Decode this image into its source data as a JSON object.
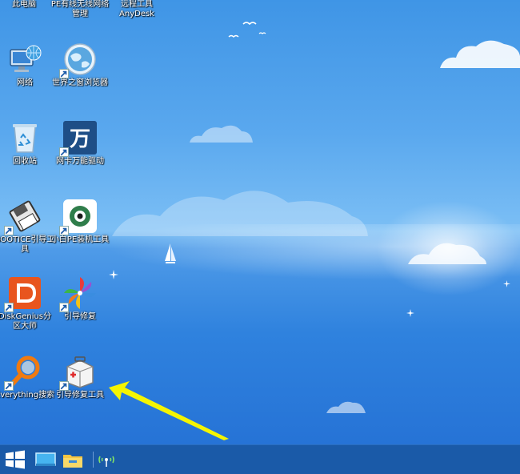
{
  "top_row": [
    {
      "label": "此电脑"
    },
    {
      "label": "PE有线无线网络管理"
    },
    {
      "label": "远程工具AnyDesk"
    }
  ],
  "icons": {
    "network": {
      "label": "网络",
      "icon": "network-computer-icon"
    },
    "browser": {
      "label": "世界之窗浏览器",
      "icon": "globe-icon"
    },
    "recycle": {
      "label": "回收站",
      "icon": "recycle-bin-icon"
    },
    "nic_driver": {
      "label": "网卡万能驱动",
      "icon": "wan-icon",
      "glyph": "万"
    },
    "bootice": {
      "label": "BOOTICE引导工具",
      "icon": "floppy-icon"
    },
    "xiaobai": {
      "label": "小白PE装机工具",
      "icon": "xiaobai-icon"
    },
    "diskgenius": {
      "label": "DiskGenius分区大师",
      "icon": "diskgenius-icon"
    },
    "boot_repair": {
      "label": "引导修复",
      "icon": "pinwheel-icon"
    },
    "everything": {
      "label": "Everything搜索",
      "icon": "magnifier-icon"
    },
    "boot_repair_tool": {
      "label": "引导修复工具",
      "icon": "first-aid-kit-icon"
    }
  },
  "taskbar": {
    "start": "windows-start-icon",
    "desktop": "show-desktop-icon",
    "explorer": "file-explorer-icon",
    "network": "wireless-network-icon"
  },
  "annotation": {
    "color": "#f5f500",
    "icon": "yellow-arrow"
  }
}
